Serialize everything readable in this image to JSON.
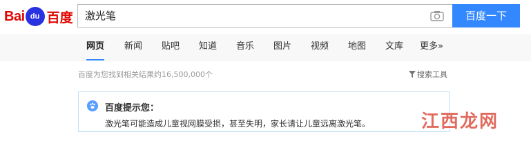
{
  "header": {
    "logo": {
      "part1": "Bai",
      "paw": "du",
      "part2": "百度"
    },
    "search": {
      "value": "激光笔",
      "placeholder": ""
    },
    "search_button": "百度一下",
    "icons": {
      "camera": "camera-icon"
    }
  },
  "nav": {
    "items": [
      "网页",
      "新闻",
      "贴吧",
      "知道",
      "音乐",
      "图片",
      "视频",
      "地图",
      "文库",
      "更多»"
    ],
    "active": "网页"
  },
  "results": {
    "count_text": "百度为您找到相关结果约16,500,000个",
    "tools_label": "搜索工具"
  },
  "tip": {
    "title": "百度提示您：",
    "text": "激光笔可能造成儿童视网膜受损，甚至失明，家长请让儿童远离激光笔。"
  },
  "watermark": {
    "text": "江西龙网"
  },
  "colors": {
    "brand_red": "#e10601",
    "brand_blue": "#2932e1",
    "button_blue": "#3388ff",
    "tip_border": "#bfe0f5"
  }
}
